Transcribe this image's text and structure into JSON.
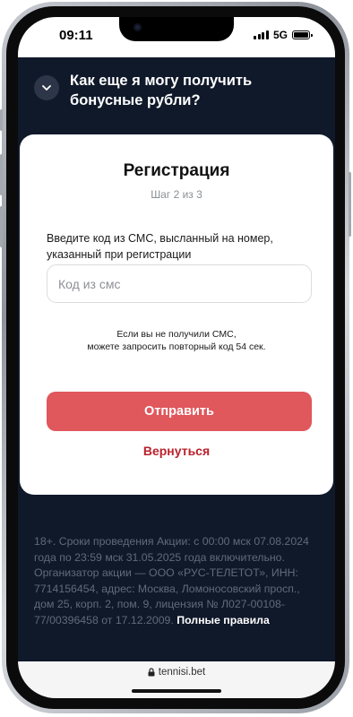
{
  "status": {
    "time": "09:11",
    "network": "5G",
    "signal_bars": 4,
    "battery_level": 1.0
  },
  "faq": {
    "question": "Как еще я могу получить бонусные рубли?",
    "icon": "chevron-down-icon"
  },
  "card": {
    "title": "Регистрация",
    "step": "Шаг 2 из 3",
    "instruction": "Введите код из СМС, высланный на номер, указанный при регистрации",
    "code_input": {
      "placeholder": "Код из смс",
      "value": ""
    },
    "resend_line1": "Если вы не получили СМС,",
    "resend_line2": "можете запросить повторный код 54 сек.",
    "submit_label": "Отправить",
    "back_label": "Вернуться"
  },
  "legal": {
    "text": "18+. Сроки проведения Акции: с 00:00 мск 07.08.2024 года по 23:59 мск 31.05.2025 года включительно. Организатор акции — ООО «РУС-ТЕЛЕТОТ», ИНН: 7714156454, адрес: Москва, Ломоносовский просп., дом 25, корп. 2, пом. 9, лицензия № Л027-00108-77/00396458 от 17.12.2009.",
    "rules_link": "Полные правила"
  },
  "browser": {
    "url": "tennisi.bet",
    "icon": "lock-icon"
  },
  "colors": {
    "background": "#10192a",
    "card": "#ffffff",
    "primary_button": "#e0575c",
    "link_red": "#b9212c",
    "legal_text": "#616a7a"
  }
}
